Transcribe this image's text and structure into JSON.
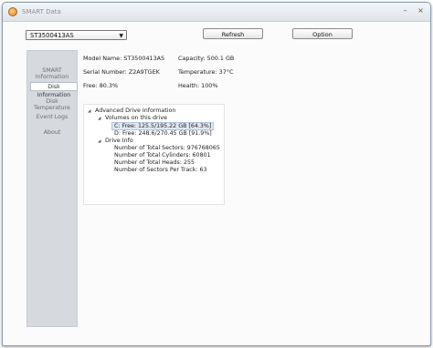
{
  "window": {
    "title": "SMART Data"
  },
  "controls": {
    "minimize": "–",
    "close": "×"
  },
  "toolbar": {
    "drive_selected": "ST3500413AS",
    "refresh_label": "Refresh",
    "option_label": "Option"
  },
  "sidebar": {
    "items": [
      {
        "label": "SMART Information",
        "active": false
      },
      {
        "label": "Disk Information",
        "active": true
      },
      {
        "label": "Disk Temperature",
        "active": false
      },
      {
        "label": "Event Logs",
        "active": false
      },
      {
        "label": "About",
        "active": false
      }
    ]
  },
  "disk": {
    "model": "Model Name: ST3500413AS",
    "capacity": "Capacity: 500.1 GB",
    "serial": "Serial Number: Z2A9TGEK",
    "temperature": "Temperature: 37°C",
    "free": "Free: 80.3%",
    "health": "Health: 100%"
  },
  "tree": {
    "root": "Advanced Drive Information",
    "volumes": "Volumes on this drive",
    "volume_c": "C: Free: 125.5/195.22 GB [64.3%]",
    "volume_d": "D: Free: 248.6/270.45 GB [91.9%]",
    "drive_info": "Drive Info",
    "sectors": "Number of Total Sectors: 976768065",
    "cylinders": "Number of Total Cylinders: 60801",
    "heads": "Number of Total Heads: 255",
    "sectors_per_track": "Number of Sectors Per Track: 63"
  }
}
